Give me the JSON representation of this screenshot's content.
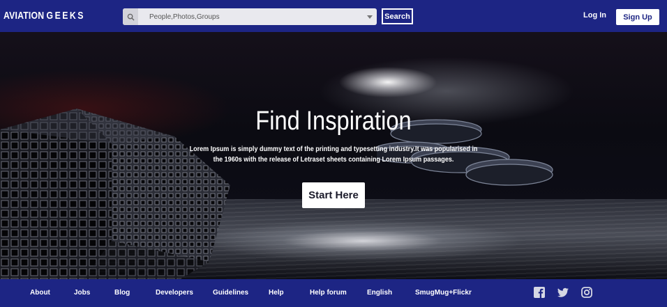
{
  "header": {
    "brand_left": "AVIATION",
    "brand_right": "GEEKS",
    "search": {
      "placeholder": "People,Photos,Groups",
      "button_label": "Search"
    },
    "login_label": "Log In",
    "signup_label": "Sign Up"
  },
  "hero": {
    "title": "Find Inspiration",
    "subtitle": "Lorem Ipsum is simply dummy text of the printing and typesetting industry.It was popularised in the 1960s with the release of Letraset sheets containing Lorem Ipsum passages.",
    "cta_label": "Start Here"
  },
  "footer": {
    "links": [
      "About",
      "Jobs",
      "Blog",
      "Developers",
      "Guidelines",
      "Help",
      "Help forum",
      "English",
      "SmugMug+Flickr"
    ],
    "social_icons": [
      "facebook-icon",
      "twitter-icon",
      "instagram-icon"
    ]
  },
  "colors": {
    "brand": "#1d2584",
    "text_on_brand": "#ffffff"
  }
}
